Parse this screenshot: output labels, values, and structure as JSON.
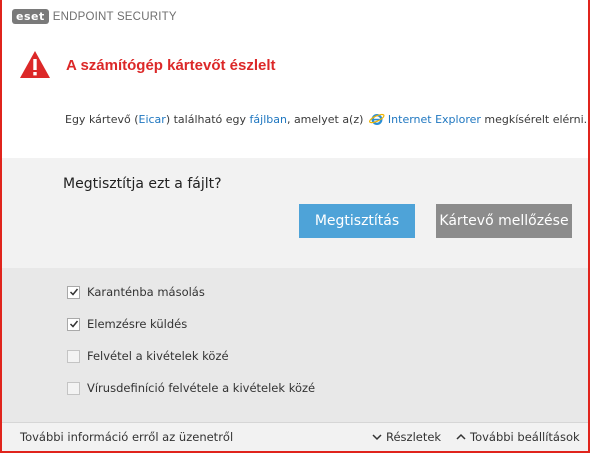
{
  "titlebar": {
    "logo_text": "eset",
    "app_name": "ENDPOINT SECURITY"
  },
  "alert": {
    "title": "A számítógép kártevőt észlelt",
    "message": {
      "part1": "Egy kártevő (",
      "threat_name": "Eicar",
      "part2": ") található egy ",
      "file_link": "fájlban",
      "part3": ", amelyet a(z) ",
      "app_link": "Internet Explorer",
      "part4": " megkísérelt elérni."
    },
    "icon": "warning-triangle-icon",
    "accent_color": "#dc2828"
  },
  "prompt": {
    "question": "Megtisztítja ezt a fájlt?",
    "clean_button": "Megtisztítás",
    "ignore_button": "Kártevő mellőzése"
  },
  "options": [
    {
      "label": "Karanténba másolás",
      "checked": true
    },
    {
      "label": "Elemzésre küldés",
      "checked": true
    },
    {
      "label": "Felvétel a kivételek közé",
      "checked": false
    },
    {
      "label": "Vírusdefiníció felvétele a kivételek közé",
      "checked": false
    }
  ],
  "footer": {
    "more_info": "További információ erről az üzenetről",
    "details": "Részletek",
    "advanced": "További beállítások"
  }
}
